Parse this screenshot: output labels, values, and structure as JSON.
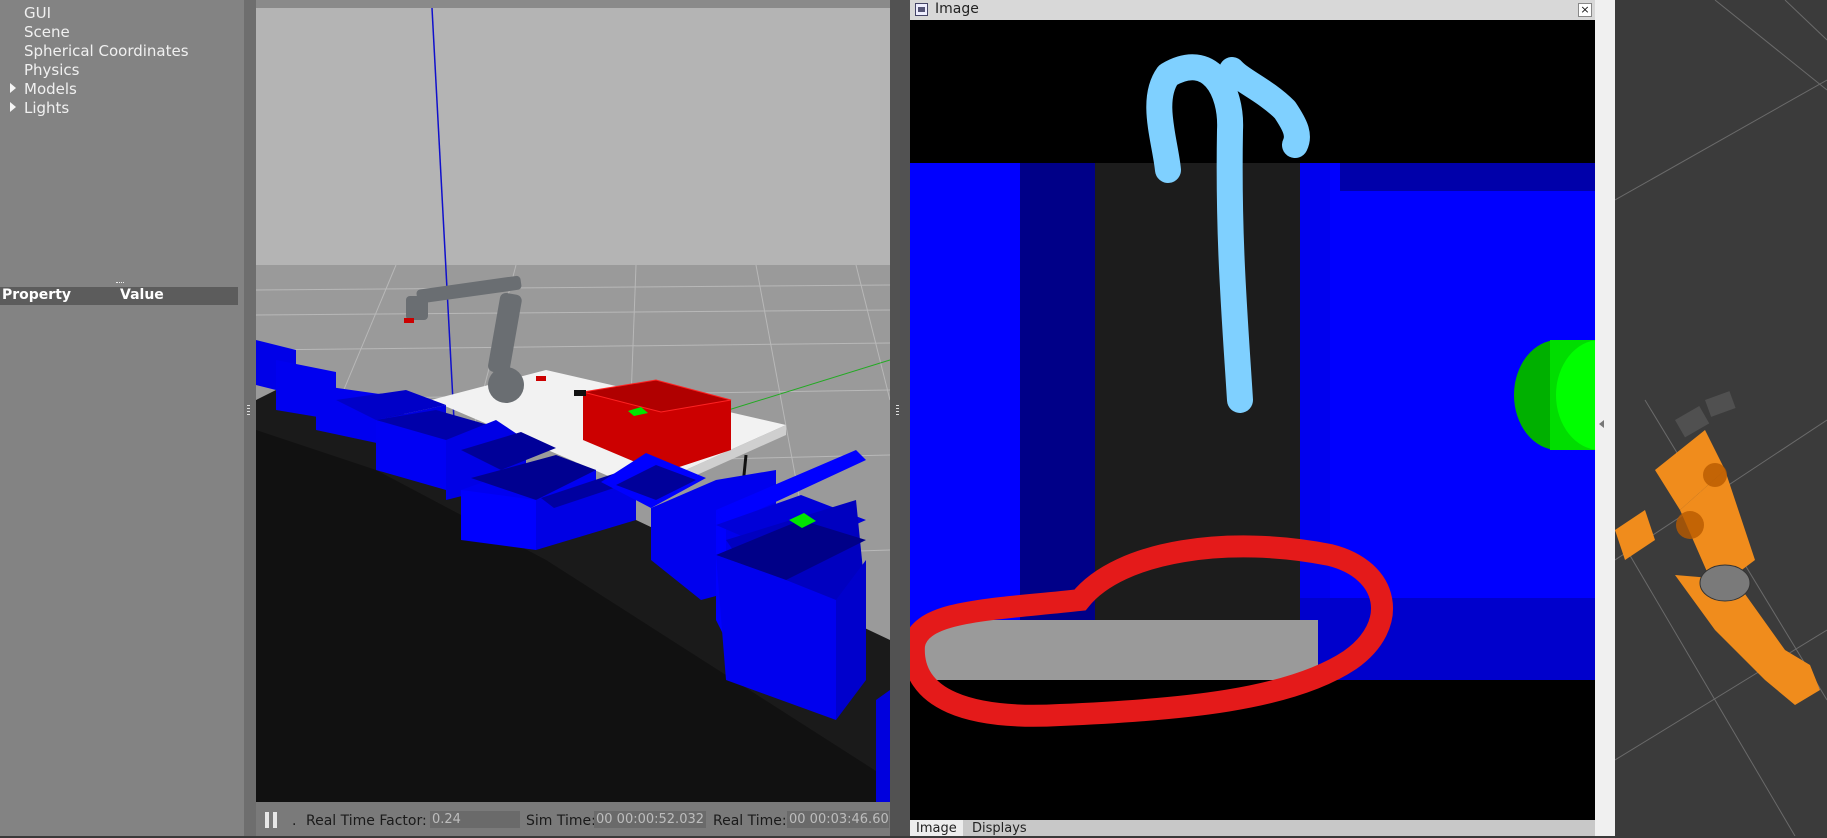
{
  "world_tree": {
    "items": [
      {
        "label": "GUI",
        "expandable": false
      },
      {
        "label": "Scene",
        "expandable": false
      },
      {
        "label": "Spherical Coordinates",
        "expandable": false
      },
      {
        "label": "Physics",
        "expandable": false
      },
      {
        "label": "Models",
        "expandable": true
      },
      {
        "label": "Lights",
        "expandable": true
      }
    ]
  },
  "property_table": {
    "col_property": "Property",
    "col_value": "Value"
  },
  "gazebo_status": {
    "real_time_factor_label": "Real Time Factor:",
    "real_time_factor_value": "0.24",
    "sim_time_label": "Sim Time:",
    "sim_time_value": "00 00:00:52.032",
    "real_time_label": "Real Time:",
    "real_time_value": "00 00:03:46.60"
  },
  "image_panel": {
    "title": "Image",
    "tabs": [
      "Image",
      "Displays"
    ]
  },
  "colors": {
    "bin_blue": "#0000ee",
    "box_red": "#cc0000",
    "annotation_red": "#e41a1a",
    "annotation_arrow": "#7fd0ff",
    "object_green": "#00ee00",
    "robot_orange": "#f08c1c"
  }
}
